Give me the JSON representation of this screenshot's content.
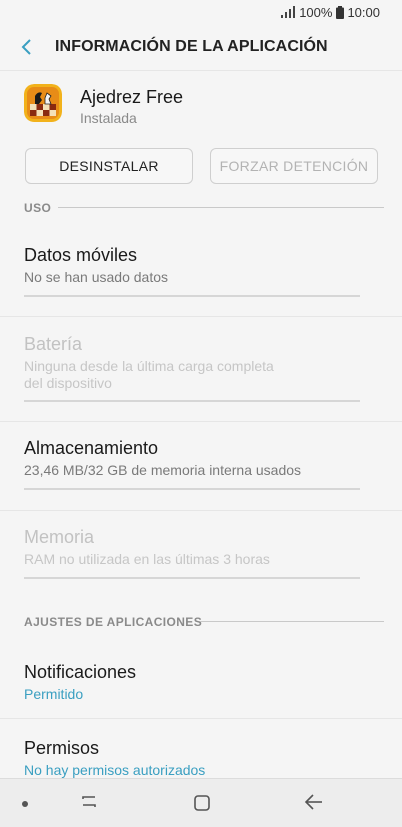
{
  "status_bar": {
    "battery": "100%",
    "time": "10:00"
  },
  "header": {
    "title": "INFORMACIÓN DE LA APLICACIÓN"
  },
  "app": {
    "name": "Ajedrez Free",
    "status": "Instalada"
  },
  "buttons": {
    "uninstall": "DESINSTALAR",
    "force_stop": "FORZAR DETENCIÓN"
  },
  "sections": {
    "usage": "USO",
    "app_settings": "AJUSTES DE APLICACIONES"
  },
  "items": {
    "mobile_data": {
      "title": "Datos móviles",
      "subtitle": "No se han usado datos"
    },
    "battery": {
      "title": "Batería",
      "subtitle_line1": "Ninguna desde la última carga completa",
      "subtitle_line2": "del dispositivo"
    },
    "storage": {
      "title": "Almacenamiento",
      "subtitle": "23,46 MB/32 GB de memoria interna usados"
    },
    "memory": {
      "title": "Memoria",
      "subtitle": "RAM no utilizada en las últimas 3 horas"
    },
    "notifications": {
      "title": "Notificaciones",
      "subtitle": "Permitido"
    },
    "permissions": {
      "title": "Permisos",
      "subtitle": "No hay permisos autorizados"
    }
  },
  "icons": {
    "back": "arrow-left-icon",
    "app": "chess-app-icon",
    "nav_recent": "recent-apps-icon",
    "nav_home": "home-icon",
    "nav_back": "back-arrow-icon"
  },
  "colors": {
    "accent": "#3a9fc1",
    "background": "#f5f5f5",
    "disabled_text": "#c2c2c2"
  }
}
